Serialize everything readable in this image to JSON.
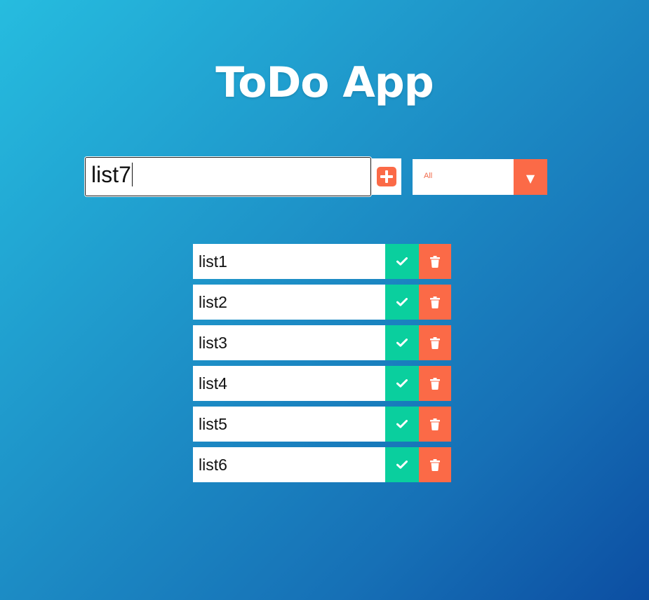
{
  "app": {
    "title": "ToDo App"
  },
  "form": {
    "input_value": "list7",
    "add_icon": "plus-square-icon",
    "filter": {
      "selected": "All",
      "arrow_icon": "triangle-down-icon"
    }
  },
  "todos": [
    {
      "text": "list1"
    },
    {
      "text": "list2"
    },
    {
      "text": "list3"
    },
    {
      "text": "list4"
    },
    {
      "text": "list5"
    },
    {
      "text": "list6"
    }
  ],
  "colors": {
    "accent": "#fb6a47",
    "complete": "#0acf9e",
    "background_start": "#26bcdf",
    "background_end": "#0c4ea2"
  }
}
